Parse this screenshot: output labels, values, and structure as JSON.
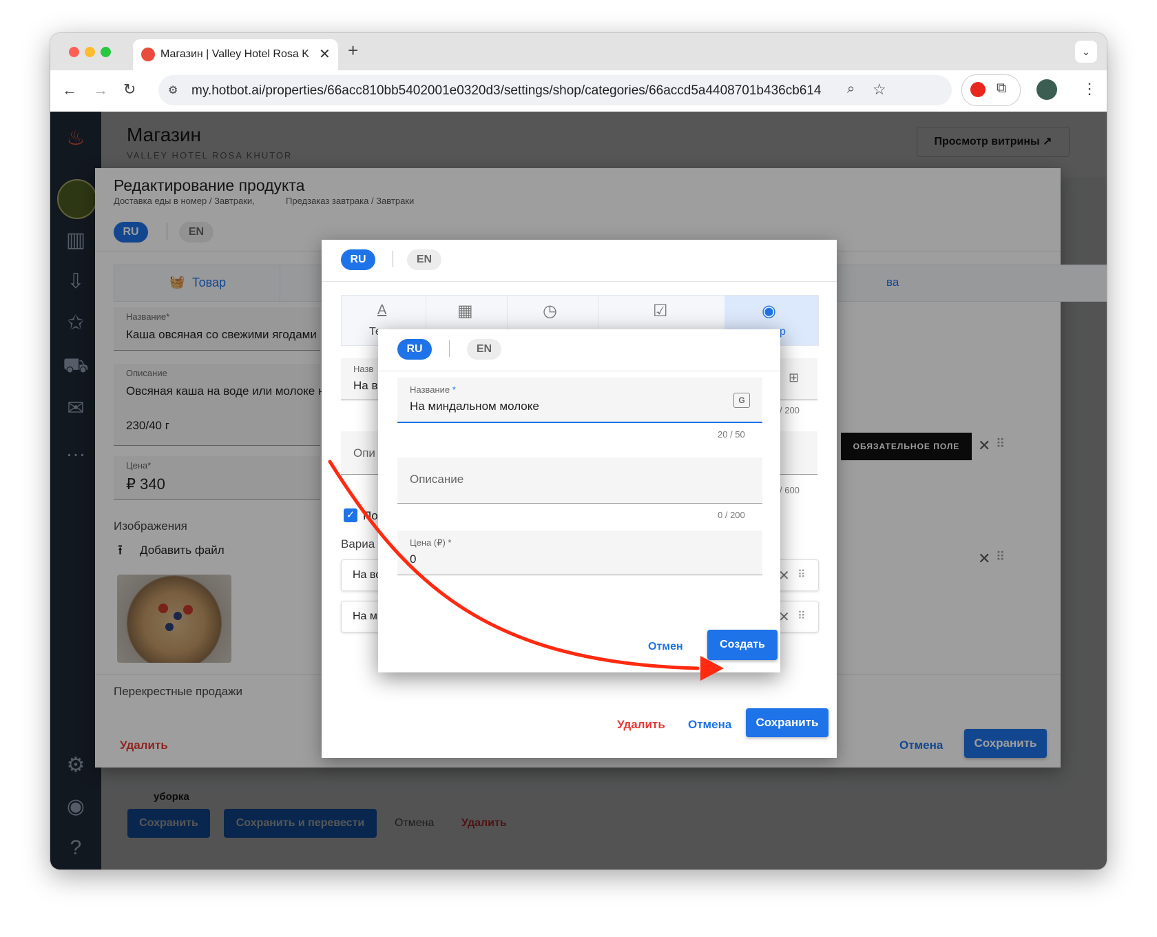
{
  "browser": {
    "tab_title": "Магазин | Valley Hotel Rosa K",
    "url": "my.hotbot.ai/properties/66acc810bb5402001e0320d3/settings/shop/categories/66accd5a4408701b436cb614"
  },
  "page": {
    "title": "Магазин",
    "subtitle": "VALLEY HOTEL ROSA KHUTOR",
    "storefront_button": "Просмотр витрины ↗"
  },
  "page_actions": {
    "save": "Сохранить",
    "save_translate": "Сохранить и перевести",
    "cancel": "Отмена",
    "delete": "Удалить",
    "partial_text": "уборка"
  },
  "product_modal": {
    "title": "Редактирование продукта",
    "breadcrumb_1": "Доставка еды в номер / Завтраки,",
    "breadcrumb_2": "Предзаказ завтрака / Завтраки",
    "lang_ru": "RU",
    "lang_en": "EN",
    "tab_product": "Товар",
    "tab_right_partial": "ва",
    "name_label": "Название*",
    "name_value": "Каша овсяная со свежими ягодами",
    "description_label": "Описание",
    "description_value": "Овсяная каша на воде или молоке н",
    "description_extra": "230/40 г",
    "price_label": "Цена*",
    "price_value": "₽ 340",
    "images_label": "Изображения",
    "add_file": "Добавить файл",
    "cross_sales": "Перекрестные продажи",
    "required_badge": "ОБЯЗАТЕЛЬНОЕ ПОЛЕ",
    "delete": "Удалить",
    "cancel": "Отмена",
    "save": "Сохранить"
  },
  "option_modal": {
    "lang_ru": "RU",
    "lang_en": "EN",
    "tab_text_partial": "Те",
    "tab_radio_partial": "р",
    "name_label_partial": "Назв",
    "name_value_partial": "На в",
    "counter_name": "/ 200",
    "description_partial": "Опи",
    "counter_desc": "/ 600",
    "checkbox_partial": "По",
    "variants_partial": "Вариа",
    "variant_1_partial": "На вс",
    "variant_2_partial": "На мі",
    "delete": "Удалить",
    "cancel": "Отмена",
    "save": "Сохранить"
  },
  "create_dialog": {
    "lang_ru": "RU",
    "lang_en": "EN",
    "name_label": "Название",
    "required_mark": "*",
    "name_value": "На миндальном молоке",
    "name_counter": "20 / 50",
    "description_placeholder": "Описание",
    "description_counter": "0 / 200",
    "price_label": "Цена (₽) *",
    "price_value": "0",
    "cancel_partial": "Отмен",
    "create": "Создать"
  },
  "colors": {
    "primary": "#1e73e8",
    "danger": "#e53935",
    "nav_bg": "#1e2734",
    "annotation_arrow": "#ff2a10"
  }
}
